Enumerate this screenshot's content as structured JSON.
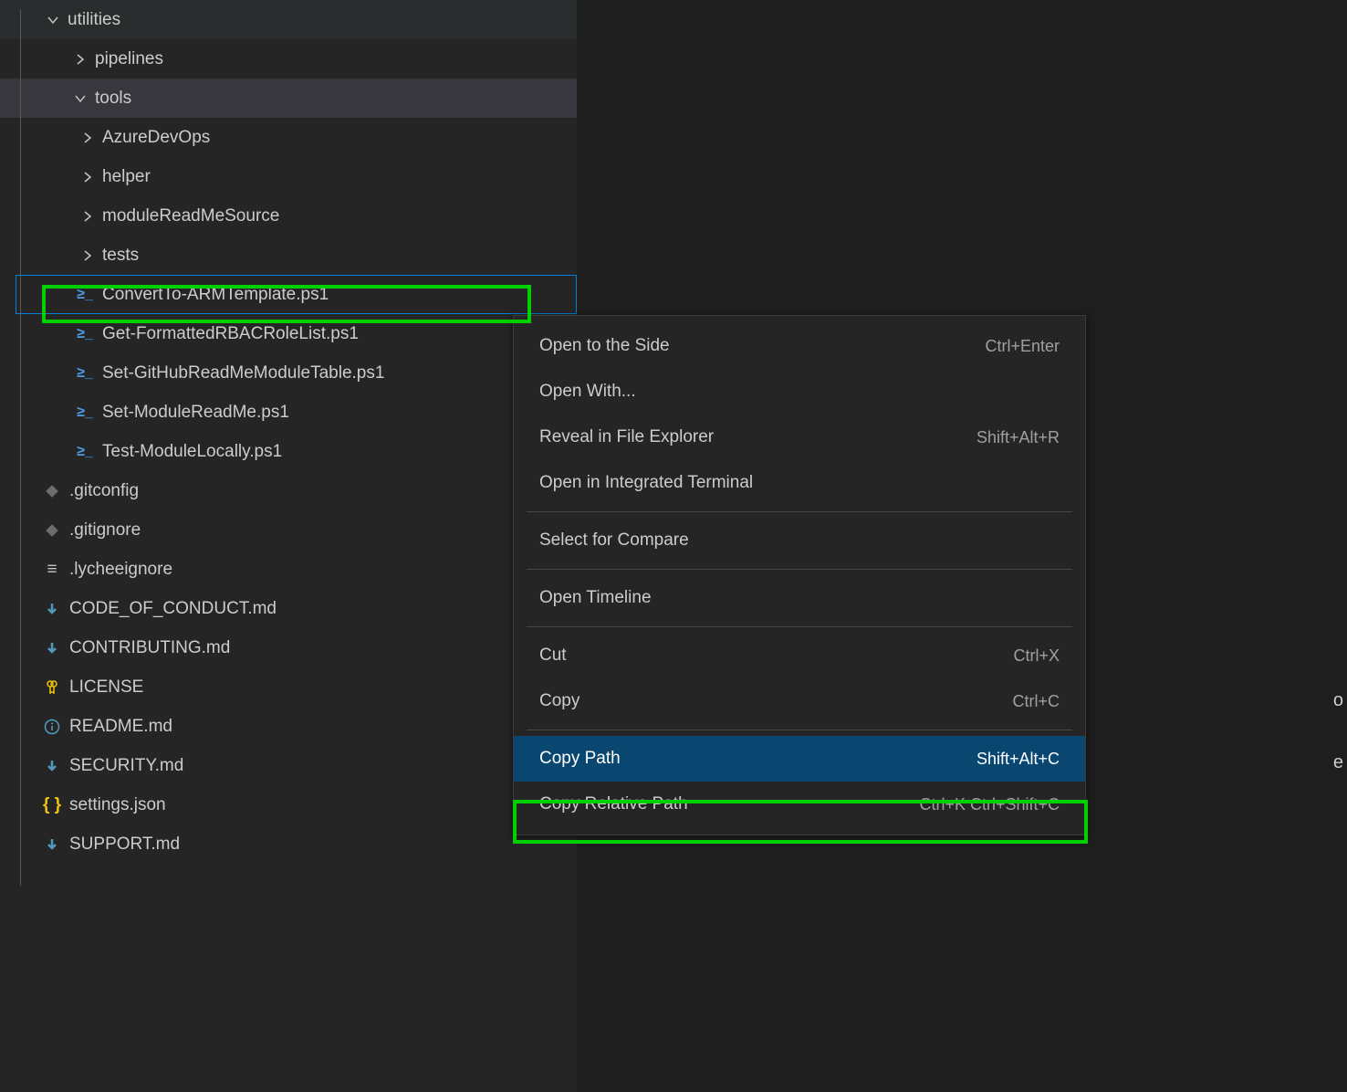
{
  "tree": {
    "utilities": "utilities",
    "pipelines": "pipelines",
    "tools": "tools",
    "azureDevOps": "AzureDevOps",
    "helper": "helper",
    "moduleReadMeSource": "moduleReadMeSource",
    "tests": "tests",
    "files": {
      "convertTo": "ConvertTo-ARMTemplate.ps1",
      "getFormatted": "Get-FormattedRBACRoleList.ps1",
      "setGitHub": "Set-GitHubReadMeModuleTable.ps1",
      "setModule": "Set-ModuleReadMe.ps1",
      "testModule": "Test-ModuleLocally.ps1"
    },
    "rootFiles": {
      "gitconfig": ".gitconfig",
      "gitignore": ".gitignore",
      "lycheeignore": ".lycheeignore",
      "codeOfConduct": "CODE_OF_CONDUCT.md",
      "contributing": "CONTRIBUTING.md",
      "license": "LICENSE",
      "readme": "README.md",
      "security": "SECURITY.md",
      "settings": "settings.json",
      "support": "SUPPORT.md"
    }
  },
  "menu": {
    "openSide": {
      "label": "Open to the Side",
      "shortcut": "Ctrl+Enter"
    },
    "openWith": {
      "label": "Open With...",
      "shortcut": ""
    },
    "reveal": {
      "label": "Reveal in File Explorer",
      "shortcut": "Shift+Alt+R"
    },
    "terminal": {
      "label": "Open in Integrated Terminal",
      "shortcut": ""
    },
    "selectCompare": {
      "label": "Select for Compare",
      "shortcut": ""
    },
    "timeline": {
      "label": "Open Timeline",
      "shortcut": ""
    },
    "cut": {
      "label": "Cut",
      "shortcut": "Ctrl+X"
    },
    "copy": {
      "label": "Copy",
      "shortcut": "Ctrl+C"
    },
    "copyPath": {
      "label": "Copy Path",
      "shortcut": "Shift+Alt+C"
    },
    "copyRel": {
      "label": "Copy Relative Path",
      "shortcut": "Ctrl+K Ctrl+Shift+C"
    }
  },
  "clipped": {
    "char1": "o",
    "char2": "e"
  }
}
